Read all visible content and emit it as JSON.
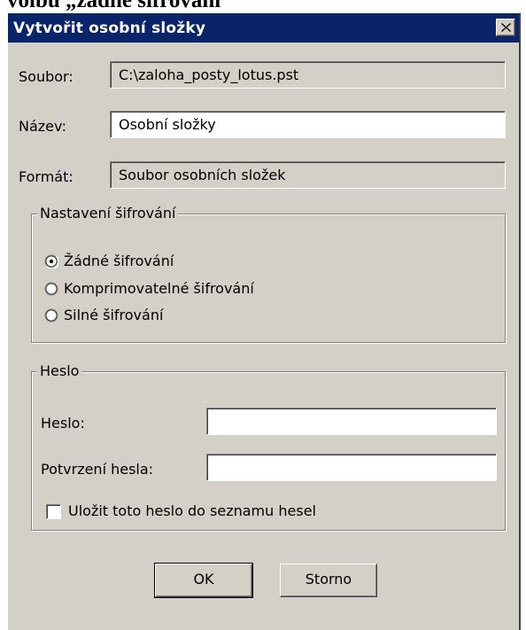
{
  "doc_heading": "volbu „žádné šifrování“",
  "dialog": {
    "title": "Vytvořit osobní složky",
    "close_icon": "close-x-icon",
    "colors": {
      "titlebar": "#0a246a",
      "face": "#d4d0c8"
    }
  },
  "fields": {
    "file_label": "Soubor:",
    "file_value": "C:\\zaloha_posty_lotus.pst",
    "name_label": "Název:",
    "name_value": "Osobní složky",
    "format_label": "Formát:",
    "format_value": "Soubor osobních složek"
  },
  "encryption": {
    "legend": "Nastavení šifrování",
    "options": [
      {
        "label": "Žádné šifrování",
        "selected": true
      },
      {
        "label": "Komprimovatelné šifrování",
        "selected": false
      },
      {
        "label": "Silné šifrování",
        "selected": false
      }
    ]
  },
  "password": {
    "legend": "Heslo",
    "password_label": "Heslo:",
    "password_value": "",
    "confirm_label": "Potvrzení hesla:",
    "confirm_value": "",
    "save_label": "Uložit toto heslo do seznamu hesel",
    "save_checked": false
  },
  "buttons": {
    "ok": "OK",
    "cancel": "Storno"
  }
}
